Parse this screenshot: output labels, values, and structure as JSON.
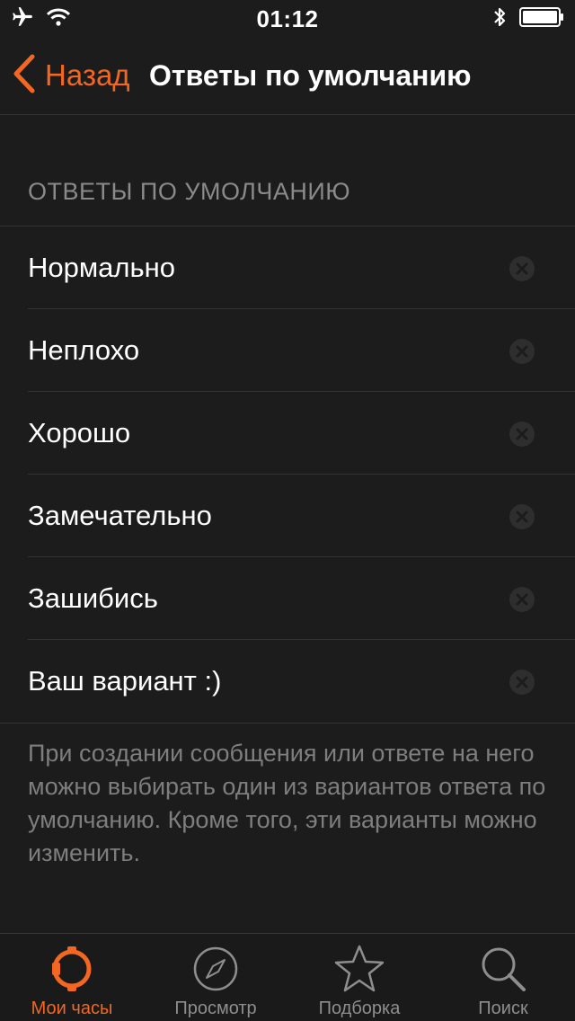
{
  "status_bar": {
    "time": "01:12"
  },
  "nav": {
    "back_label": "Назад",
    "title": "Ответы по умолчанию"
  },
  "section": {
    "header": "ОТВЕТЫ ПО УМОЛЧАНИЮ"
  },
  "replies": [
    {
      "label": "Нормально"
    },
    {
      "label": "Неплохо"
    },
    {
      "label": "Хорошо"
    },
    {
      "label": "Замечательно"
    },
    {
      "label": "Зашибись"
    },
    {
      "label": "Ваш вариант :)"
    }
  ],
  "footer": {
    "text": "При создании сообщения или ответе на него можно выбирать один из вариантов ответа по умолчанию. Кроме того, эти варианты можно изменить."
  },
  "tabs": [
    {
      "label": "Мои часы",
      "icon": "watch-icon",
      "active": true
    },
    {
      "label": "Просмотр",
      "icon": "compass-icon",
      "active": false
    },
    {
      "label": "Подборка",
      "icon": "star-icon",
      "active": false
    },
    {
      "label": "Поиск",
      "icon": "search-icon",
      "active": false
    }
  ],
  "colors": {
    "accent": "#f26722",
    "background": "#1c1c1c",
    "separator": "#333333",
    "secondary_text": "#8a8a8a"
  }
}
